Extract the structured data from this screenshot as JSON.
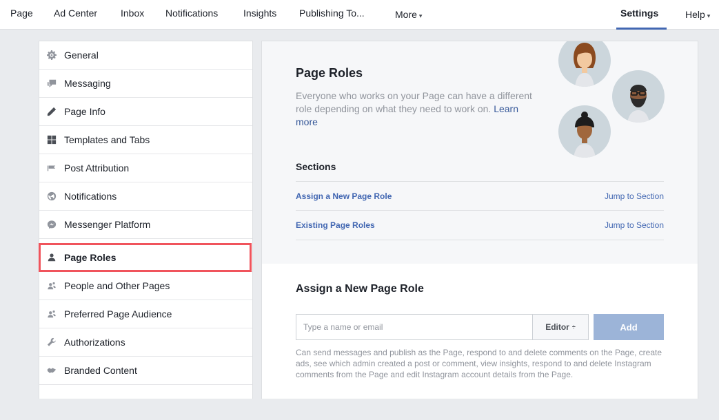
{
  "topnav": {
    "items": [
      {
        "label": "Page"
      },
      {
        "label": "Ad Center"
      },
      {
        "label": "Inbox"
      },
      {
        "label": "Notifications"
      },
      {
        "label": "Insights"
      },
      {
        "label": "Publishing To..."
      },
      {
        "label": "More",
        "caret": "▾"
      },
      {
        "label": "Settings",
        "active": true
      },
      {
        "label": "Help",
        "caret": "▾"
      }
    ]
  },
  "sidebar": {
    "items": [
      {
        "label": "General",
        "icon": "gear-icon"
      },
      {
        "label": "Messaging",
        "icon": "chat-bubbles-icon"
      },
      {
        "label": "Page Info",
        "icon": "pencil-icon"
      },
      {
        "label": "Templates and Tabs",
        "icon": "grid-icon"
      },
      {
        "label": "Post Attribution",
        "icon": "flag-icon"
      },
      {
        "label": "Notifications",
        "icon": "globe-icon"
      },
      {
        "label": "Messenger Platform",
        "icon": "messenger-icon"
      },
      {
        "label": "Page Roles",
        "icon": "person-icon",
        "selected": true
      },
      {
        "label": "People and Other Pages",
        "icon": "people-icon"
      },
      {
        "label": "Preferred Page Audience",
        "icon": "people-icon"
      },
      {
        "label": "Authorizations",
        "icon": "wrench-icon"
      },
      {
        "label": "Branded Content",
        "icon": "handshake-icon"
      }
    ]
  },
  "main": {
    "title": "Page Roles",
    "description": "Everyone who works on your Page can have a different role depending on what they need to work on.",
    "learn_more": "Learn more",
    "sections_label": "Sections",
    "sections": [
      {
        "label": "Assign a New Page Role",
        "jump": "Jump to Section"
      },
      {
        "label": "Existing Page Roles",
        "jump": "Jump to Section"
      }
    ],
    "assign": {
      "title": "Assign a New Page Role",
      "input_placeholder": "Type a name or email",
      "role_value": "Editor",
      "role_caret": "÷",
      "add_label": "Add",
      "role_description": "Can send messages and publish as the Page, respond to and delete comments on the Page, create ads, see which admin created a post or comment, view insights, respond to and delete Instagram comments from the Page and edit Instagram account details from the Page."
    }
  },
  "colors": {
    "link": "#4267b2",
    "highlight": "#f0545c",
    "add_button": "#9cb4d8"
  }
}
